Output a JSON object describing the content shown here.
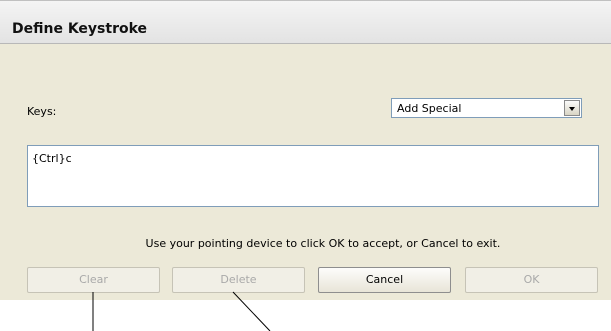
{
  "dialog": {
    "title": "Define Keystroke",
    "keys_label": "Keys:",
    "add_special": {
      "selected": "Add Special"
    },
    "keystroke_value": "{Ctrl}c",
    "hint": "Use your pointing device to click OK to accept, or Cancel to exit.",
    "buttons": {
      "clear": "Clear",
      "delete": "Delete",
      "cancel": "Cancel",
      "ok": "OK"
    }
  },
  "colors": {
    "dialog_background": "#ece9d8",
    "field_border": "#7f9db9",
    "disabled_text": "#a9a9a9"
  }
}
